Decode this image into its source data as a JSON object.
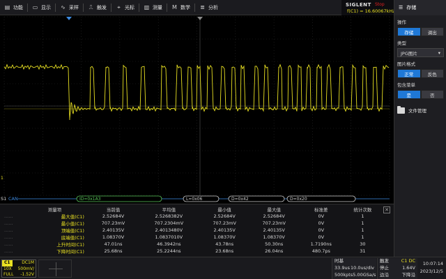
{
  "menu": [
    {
      "icon": "function-icon",
      "glyph": "▤",
      "label": "功能"
    },
    {
      "icon": "display-icon",
      "glyph": "▭",
      "label": "显示"
    },
    {
      "icon": "acquire-icon",
      "glyph": "∿",
      "label": "采样"
    },
    {
      "icon": "trigger-icon",
      "glyph": "⎍",
      "label": "触发"
    },
    {
      "icon": "cursor-icon",
      "glyph": "⌖",
      "label": "光标"
    },
    {
      "icon": "measure-icon",
      "glyph": "▥",
      "label": "测量"
    },
    {
      "icon": "math-icon",
      "glyph": "M",
      "label": "数学"
    },
    {
      "icon": "analysis-icon",
      "glyph": "≣",
      "label": "分析"
    }
  ],
  "brand": {
    "logo": "SIGLENT",
    "state": "Stop",
    "freq": "f(C1) = 16.60067kHz"
  },
  "panel": {
    "title": "存储",
    "operation_label": "操作",
    "operation_options": [
      "存储",
      "调出"
    ],
    "operation_active": 0,
    "type_label": "类型",
    "type_value": "JPG图片",
    "format_label": "图片格式",
    "format_options": [
      "正常",
      "反色"
    ],
    "format_active": 0,
    "menu_label": "包含菜单",
    "menu_options": [
      "是",
      "否"
    ],
    "menu_active": 0,
    "file_manager": "文件管理"
  },
  "screen": {
    "trace_color": "#e8e022",
    "ch1_marker": "1",
    "s1_label": "S1",
    "bus_name": "CAN",
    "bus_frames": [
      "ID=0x1A3",
      "L=0x06",
      "D=0x42",
      "D=0x20"
    ]
  },
  "measure": {
    "headers": [
      "测量项",
      "当前值",
      "平均值",
      "最小值",
      "最大值",
      "标准差",
      "统计次数"
    ],
    "rows": [
      [
        "最大值(C1)",
        "2.52684V",
        "2.5268382V",
        "2.52684V",
        "2.52684V",
        "0V",
        "1"
      ],
      [
        "最小值(C1)",
        "707.23mV",
        "707.2304mV",
        "707.23mV",
        "707.23mV",
        "0V",
        "1"
      ],
      [
        "顶端值(C1)",
        "2.40135V",
        "2.4013480V",
        "2.40135V",
        "2.40135V",
        "0V",
        "1"
      ],
      [
        "底端值(C1)",
        "1.08370V",
        "1.0837010V",
        "1.08370V",
        "1.08370V",
        "0V",
        "1"
      ],
      [
        "上升时间(C1)",
        "47.01ns",
        "46.3942ns",
        "43.78ns",
        "50.30ns",
        "1.7190ns",
        "30"
      ],
      [
        "下降时间(C1)",
        "25.68ns",
        "25.2244ns",
        "23.68ns",
        "26.04ns",
        "480.7ps",
        "31"
      ]
    ],
    "dots": "......"
  },
  "status": {
    "ch1": {
      "tag": "C1",
      "coupling": "DC1M",
      "probe": "10X",
      "scale": "500mV/",
      "bw": "FULL",
      "offset": "-1.52V"
    },
    "timebase": {
      "title": "时基",
      "pos": "33.9us",
      "scale": "10.0us/div",
      "memory": "500kpts",
      "rate": "5.00GSa/s"
    },
    "trigger": {
      "title": "触发",
      "source": "C1 DC",
      "mode": "停止",
      "level": "1.64V",
      "type": "边沿",
      "slope": "下降沿"
    },
    "clock": {
      "time": "10:07:14",
      "date": "2023/12/5"
    }
  }
}
